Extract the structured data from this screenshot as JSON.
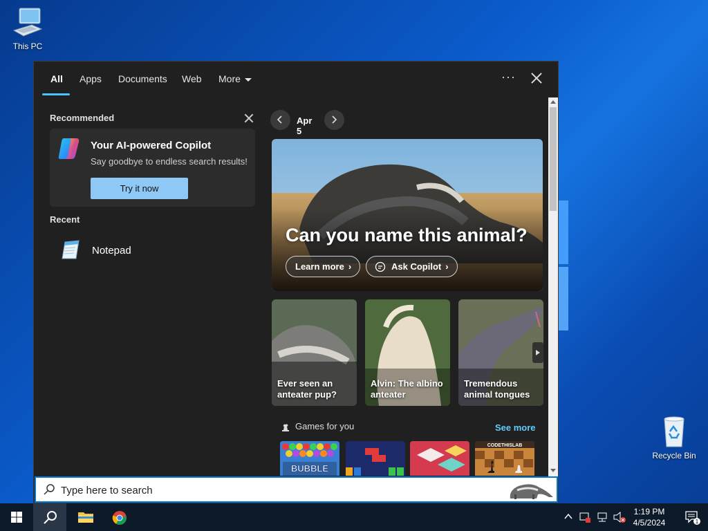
{
  "desktop": {
    "this_pc_label": "This PC",
    "recycle_bin_label": "Recycle Bin"
  },
  "tabs": [
    {
      "label": "All",
      "active": true
    },
    {
      "label": "Apps"
    },
    {
      "label": "Documents"
    },
    {
      "label": "Web"
    },
    {
      "label": "More"
    }
  ],
  "options_label": "···",
  "left": {
    "recommended_title": "Recommended",
    "copilot": {
      "title": "Your AI-powered Copilot",
      "subtitle": "Say goodbye to endless search results!",
      "button": "Try it now"
    },
    "recent_title": "Recent",
    "recent_items": [
      {
        "label": "Notepad",
        "icon": "notepad-icon"
      }
    ]
  },
  "right": {
    "date": "Apr 5",
    "hero": {
      "title": "Can you name this animal?",
      "learn_more": "Learn more",
      "ask_copilot": "Ask Copilot"
    },
    "tiles": [
      {
        "label": "Ever seen an anteater pup?"
      },
      {
        "label": "Alvin: The albino anteater"
      },
      {
        "label": "Tremendous animal tongues"
      }
    ],
    "games_title": "Games for you",
    "see_more": "See more",
    "games": [
      "BUBBLE SHOOTER HD",
      "Block puzzle",
      "Color cubes",
      "CODETHISLAB chess"
    ]
  },
  "search": {
    "placeholder": "Type here to search"
  },
  "taskbar": {
    "apps": [
      "start-button",
      "search-button",
      "file-explorer",
      "chrome"
    ],
    "time": "1:19 PM",
    "date": "4/5/2024",
    "notification_count": "1"
  },
  "colors": {
    "accent": "#4cc2ff",
    "link": "#60cdff",
    "panel_bg": "#202020",
    "try_button": "#8ec8f6"
  }
}
